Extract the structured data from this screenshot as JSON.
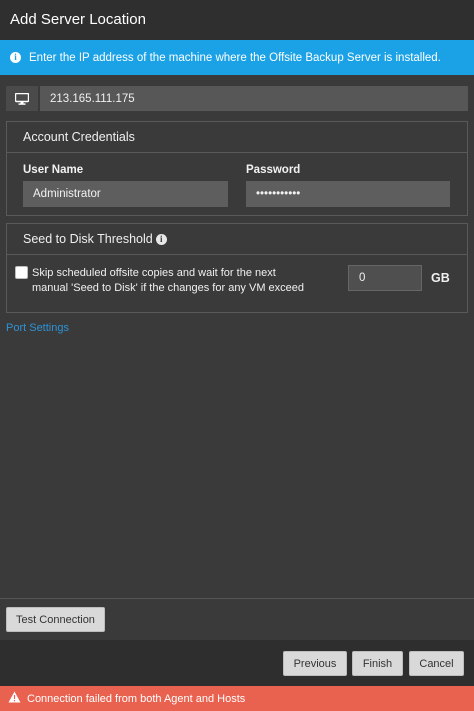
{
  "window": {
    "title": "Add Server Location"
  },
  "info_banner": {
    "icon": "info-icon",
    "text": "Enter the IP address of the machine where the Offsite Backup Server is installed."
  },
  "server": {
    "icon": "monitor-icon",
    "ip_address": "213.165.111.175"
  },
  "credentials": {
    "title": "Account Credentials",
    "username_label": "User Name",
    "username_value": "Administrator",
    "password_label": "Password",
    "password_value": "•••••••••••"
  },
  "seed": {
    "title": "Seed to Disk Threshold",
    "info_icon": "info-icon",
    "checked": false,
    "line1": "Skip scheduled offsite copies and wait for the next",
    "line2": "manual 'Seed to Disk' if the changes for any VM exceed",
    "threshold_value": "0",
    "unit": "GB"
  },
  "port_settings_link": "Port Settings",
  "test_connection_label": "Test Connection",
  "buttons": {
    "previous": "Previous",
    "finish": "Finish",
    "cancel": "Cancel"
  },
  "error": {
    "icon": "warning-icon",
    "text": "Connection failed from both Agent and Hosts",
    "color": "#e9614f"
  },
  "colors": {
    "accent": "#1ba2e6",
    "link": "#2e93d6",
    "background": "#3a3a3a"
  }
}
